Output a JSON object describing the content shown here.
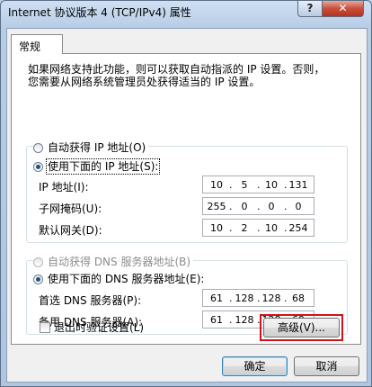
{
  "window": {
    "title": "Internet 协议版本 4 (TCP/IPv4) 属性",
    "help_label": "?",
    "close_label": "✕"
  },
  "tab": {
    "label": "常规"
  },
  "description": {
    "line1": "如果网络支持此功能，则可以获取自动指派的 IP 设置。否则，",
    "line2": "您需要从网络系统管理员处获得适当的 IP 设置。"
  },
  "ip": {
    "auto_label": "自动获得 IP 地址(O)",
    "manual_label": "使用下面的 IP 地址(S):",
    "selected": "manual",
    "fields": [
      {
        "label": "IP 地址(I):",
        "octets": [
          "10",
          "5",
          "10",
          "131"
        ]
      },
      {
        "label": "子网掩码(U):",
        "octets": [
          "255",
          "0",
          "0",
          "0"
        ]
      },
      {
        "label": "默认网关(D):",
        "octets": [
          "10",
          "2",
          "10",
          "254"
        ]
      }
    ]
  },
  "dns": {
    "auto_label": "自动获得 DNS 服务器地址(B)",
    "manual_label": "使用下面的 DNS 服务器地址(E):",
    "selected": "manual",
    "fields": [
      {
        "label": "首选 DNS 服务器(P):",
        "octets": [
          "61",
          "128",
          "128",
          "68"
        ]
      },
      {
        "label": "备用 DNS 服务器(A):",
        "octets": [
          "61",
          "128",
          "128",
          "69"
        ]
      }
    ]
  },
  "validate_label": "退出时验证设置(L)",
  "advanced_label": "高级(V)...",
  "ok_label": "确定",
  "cancel_label": "取消",
  "colors": {
    "highlight": "#d0121b"
  }
}
